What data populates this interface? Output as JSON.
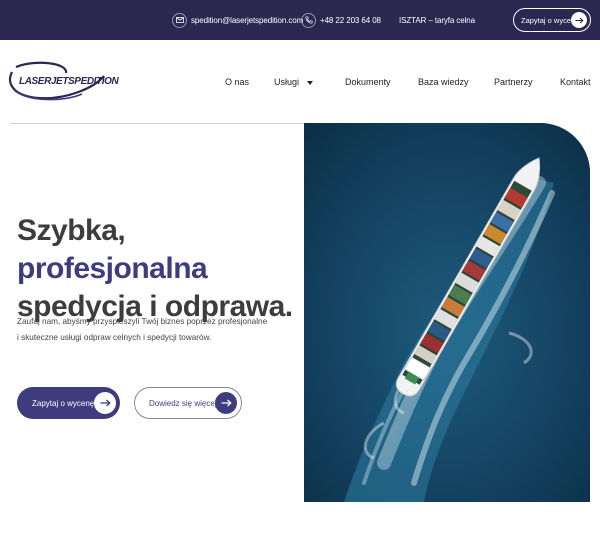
{
  "topbar": {
    "email": "spedition@laserjetspedition.com",
    "phone": "+48 22 203 64 08",
    "isztar": "ISZTAR – taryfa celna",
    "quote_button": "Zapytaj o wycenę",
    "icons": {
      "email": "envelope-icon",
      "phone": "phone-icon",
      "arrow": "arrow-right-icon"
    }
  },
  "logo": {
    "text": "LASERJETSPEDITION"
  },
  "nav": {
    "items": [
      {
        "label": "O nas"
      },
      {
        "label": "Usługi",
        "has_dropdown": true
      },
      {
        "label": "Dokumenty"
      },
      {
        "label": "Baza wiedzy"
      },
      {
        "label": "Partnerzy"
      },
      {
        "label": "Kontakt"
      }
    ]
  },
  "hero": {
    "heading_part1": "Szybka, ",
    "heading_accent": "profesjonalna",
    "heading_line2": "spedycja i odprawa.",
    "paragraph_line1": "Zaufaj nam, abyśmy przyspieszyli Twój biznes poprzez profesjonalne",
    "paragraph_line2": "i skuteczne usługi odpraw celnych i spedycji towarów.",
    "primary_button": "Zapytaj o wycenę",
    "secondary_button": "Dowiedz się więcej",
    "image_alt": "container-ship-aerial"
  },
  "colors": {
    "brand_dark": "#2c2751",
    "accent": "#3f3b7f",
    "text": "#3d3d3f"
  }
}
